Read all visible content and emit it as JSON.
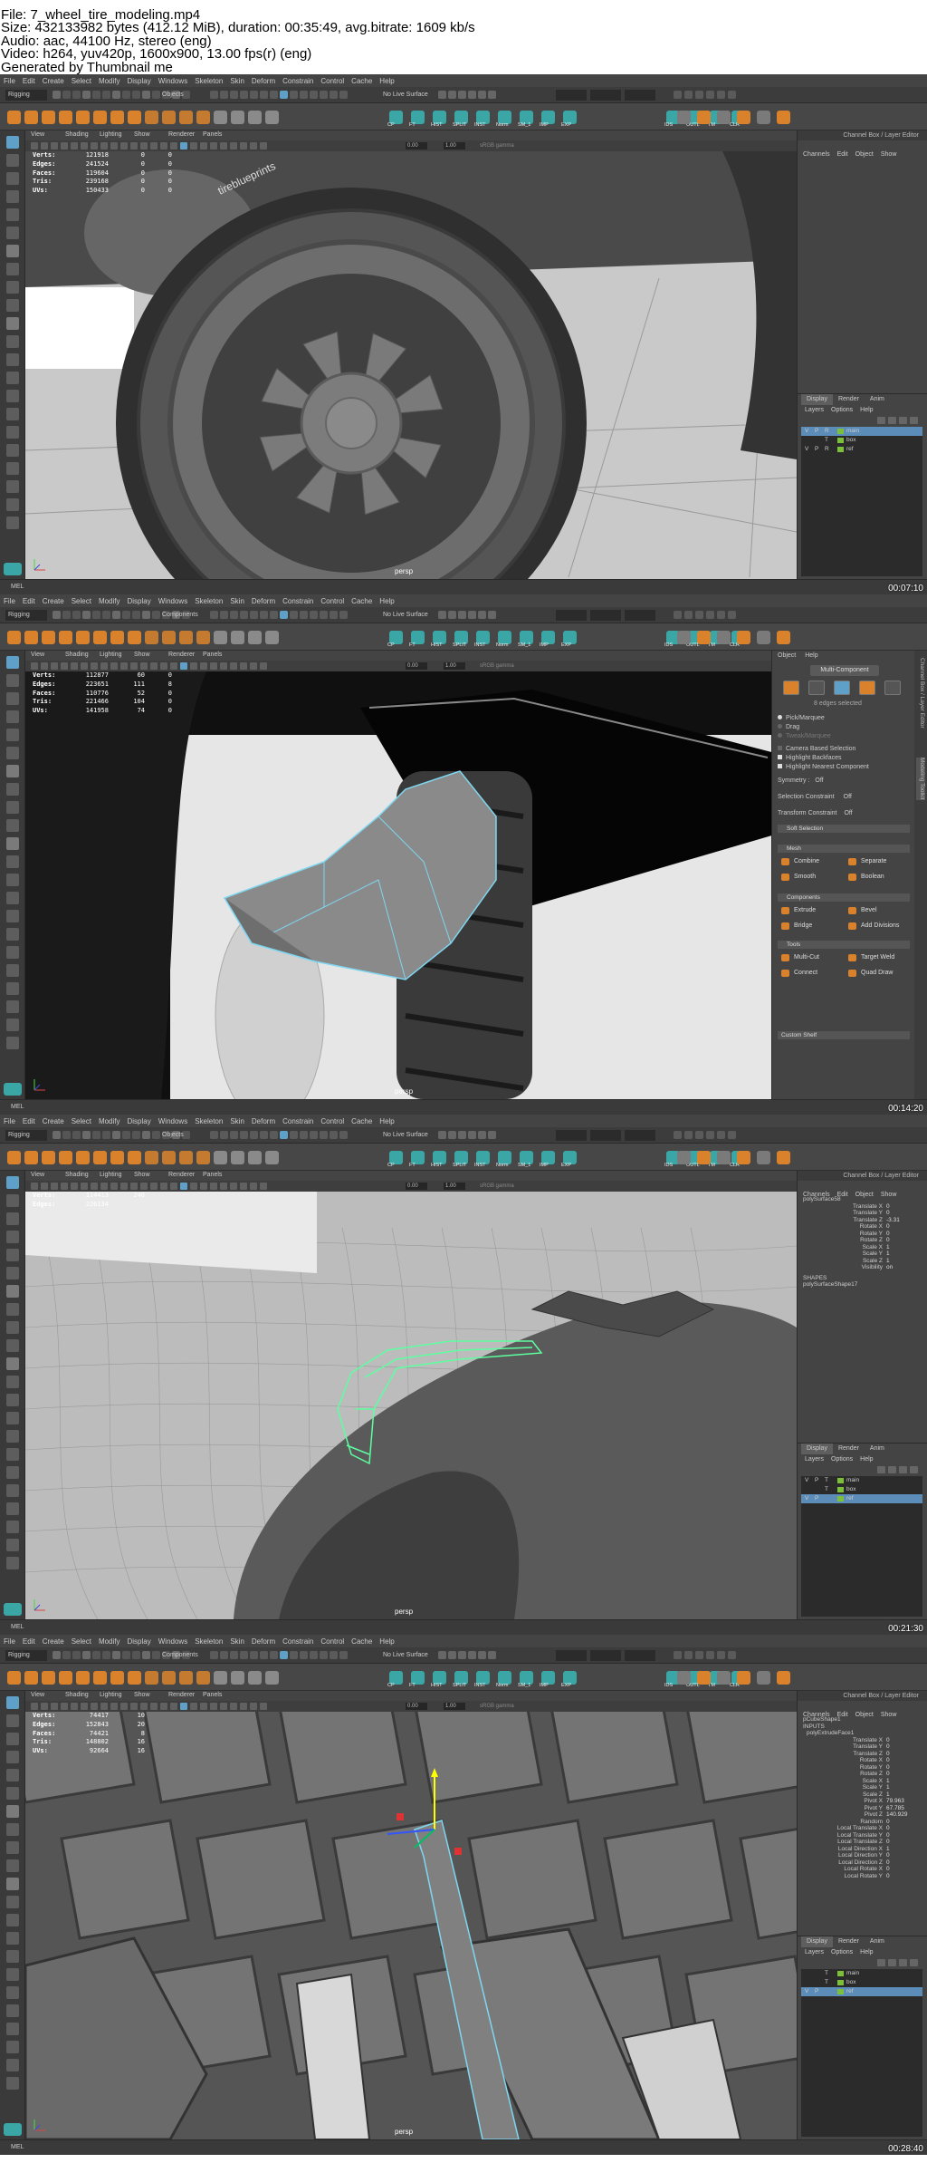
{
  "header": {
    "line1": "File: 7_wheel_tire_modeling.mp4",
    "line2": "Size: 432133982 bytes (412.12 MiB), duration: 00:35:49, avg.bitrate: 1609 kb/s",
    "line3": "Audio: aac, 44100 Hz, stereo (eng)",
    "line4": "Video: h264, yuv420p, 1600x900, 13.00 fps(r) (eng)",
    "line5": "Generated by Thumbnail me"
  },
  "menu": [
    "File",
    "Edit",
    "Create",
    "Select",
    "Modify",
    "Display",
    "Windows",
    "Skeleton",
    "Skin",
    "Deform",
    "Constrain",
    "Control",
    "Cache",
    "Help"
  ],
  "panel_menu": [
    "View",
    "Shading",
    "Lighting",
    "Show",
    "Renderer",
    "Panels"
  ],
  "mode": "Rigging",
  "live_surface": "No Live Surface",
  "shelf_labels": [
    "CP",
    "FT",
    "HIST",
    "SPLIT",
    "INST",
    "Norm",
    "SM_1",
    "IMP",
    "EXP",
    "IDS",
    "OUTL",
    "TM",
    "CLR"
  ],
  "cmd_label": "MEL",
  "camera": "persp",
  "gamma": "sRGB gamma",
  "exposure": "0.00",
  "gamma_value": "1.00",
  "colors": {
    "select_blue": "#5b8db8",
    "wire_cyan": "#7fd6f0",
    "wire_green": "#5dffa0",
    "orange_icon": "#d9822b",
    "teal_icon": "#3ba6a6",
    "layer_green": "#7bbf3a"
  },
  "frames": [
    {
      "timestamp": "00:07:10",
      "select_mode": "Objects",
      "hud": [
        [
          "Verts:",
          "121918",
          "0",
          "0"
        ],
        [
          "Edges:",
          "241524",
          "0",
          "0"
        ],
        [
          "Faces:",
          "119604",
          "0",
          "0"
        ],
        [
          "Tris:",
          "239168",
          "0",
          "0"
        ],
        [
          "UVs:",
          "150433",
          "0",
          "0"
        ]
      ],
      "panel_title": "Channel Box / Layer Editor",
      "cb_menu": [
        "Channels",
        "Edit",
        "Object",
        "Show"
      ],
      "layer_tabs": [
        "Display",
        "Render",
        "Anim"
      ],
      "layer_menu": [
        "Layers",
        "Options",
        "Help"
      ],
      "layers": [
        {
          "v": "V",
          "p": "P",
          "r": "R",
          "name": "main",
          "sel": true
        },
        {
          "v": "",
          "p": "",
          "r": "T",
          "name": "box",
          "sel": false
        },
        {
          "v": "V",
          "p": "P",
          "r": "R",
          "name": "ref",
          "sel": false
        }
      ]
    },
    {
      "timestamp": "00:14:20",
      "select_mode": "Components",
      "hud": [
        [
          "Verts:",
          "112877",
          "60",
          "0"
        ],
        [
          "Edges:",
          "223651",
          "111",
          "8"
        ],
        [
          "Faces:",
          "110776",
          "52",
          "0"
        ],
        [
          "Tris:",
          "221466",
          "104",
          "0"
        ],
        [
          "UVs:",
          "141958",
          "74",
          "0"
        ]
      ],
      "toolkit": {
        "menu": [
          "Object",
          "Help"
        ],
        "multi": "Multi-Component",
        "selected": "8 edges selected",
        "options": [
          "Pick/Marquee",
          "Drag",
          "Tweak/Marquee",
          "Camera Based Selection",
          "Highlight Backfaces",
          "Highlight Nearest Component"
        ],
        "symmetry": "Symmetry :",
        "symmetry_value": "Off",
        "sel_constraint": "Selection Constraint",
        "sel_constraint_value": "Off",
        "transform_constraint": "Transform Constraint",
        "transform_constraint_value": "Off",
        "soft": "Soft Selection",
        "mesh": "Mesh",
        "components": "Components",
        "tools": "Tools",
        "mesh_btns": [
          "Combine",
          "Separate",
          "Smooth",
          "Boolean"
        ],
        "comp_btns": [
          "Extrude",
          "Bevel",
          "Bridge",
          "Add Divisions"
        ],
        "tool_btns": [
          "Multi-Cut",
          "Target Weld",
          "Connect",
          "Quad Draw"
        ],
        "custom": "Custom Shelf",
        "vtabs": [
          "Channel Box / Layer Editor",
          "Modeling Toolkit"
        ]
      }
    },
    {
      "timestamp": "00:21:30",
      "select_mode": "Objects",
      "hud": [
        [
          "Verts:",
          "114413",
          "240",
          ""
        ],
        [
          "Edges:",
          "226134",
          "",
          ""
        ]
      ],
      "panel_title": "Channel Box / Layer Editor",
      "cb_menu": [
        "Channels",
        "Edit",
        "Object",
        "Show"
      ],
      "object": "polySurface58",
      "attrs": [
        [
          "Translate X",
          "0"
        ],
        [
          "Translate Y",
          "0"
        ],
        [
          "Translate Z",
          "-3.31"
        ],
        [
          "Rotate X",
          "0"
        ],
        [
          "Rotate Y",
          "0"
        ],
        [
          "Rotate Z",
          "0"
        ],
        [
          "Scale X",
          "1"
        ],
        [
          "Scale Y",
          "1"
        ],
        [
          "Scale Z",
          "1"
        ],
        [
          "Visibility",
          "on"
        ]
      ],
      "shapes": "SHAPES",
      "shape": "polySurfaceShape17",
      "layer_tabs": [
        "Display",
        "Render",
        "Anim"
      ],
      "layer_menu": [
        "Layers",
        "Options",
        "Help"
      ],
      "layers": [
        {
          "v": "V",
          "p": "P",
          "r": "T",
          "name": "main",
          "sel": false
        },
        {
          "v": "",
          "p": "",
          "r": "T",
          "name": "box",
          "sel": false
        },
        {
          "v": "V",
          "p": "P",
          "r": "",
          "name": "ref",
          "sel": true
        }
      ]
    },
    {
      "timestamp": "00:28:40",
      "select_mode": "Components",
      "hud": [
        [
          "Verts:",
          "74417",
          "10",
          ""
        ],
        [
          "Edges:",
          "152843",
          "20",
          ""
        ],
        [
          "Faces:",
          "74421",
          "8",
          ""
        ],
        [
          "Tris:",
          "148802",
          "16",
          ""
        ],
        [
          "UVs:",
          "92664",
          "16",
          ""
        ]
      ],
      "panel_title": "Channel Box / Layer Editor",
      "cb_menu": [
        "Channels",
        "Edit",
        "Object",
        "Show"
      ],
      "object": "pCubeShape1",
      "inputs": "INPUTS",
      "input_node": "polyExtrudeFace1",
      "attrs": [
        [
          "Translate X",
          "0"
        ],
        [
          "Translate Y",
          "0"
        ],
        [
          "Translate Z",
          "0"
        ],
        [
          "Rotate X",
          "0"
        ],
        [
          "Rotate Y",
          "0"
        ],
        [
          "Rotate Z",
          "0"
        ],
        [
          "Scale X",
          "1"
        ],
        [
          "Scale Y",
          "1"
        ],
        [
          "Scale Z",
          "1"
        ],
        [
          "Pivot X",
          "79.963"
        ],
        [
          "Pivot Y",
          "67.785"
        ],
        [
          "Pivot Z",
          "140.929"
        ],
        [
          "Random",
          "0"
        ],
        [
          "Local Translate X",
          "0"
        ],
        [
          "Local Translate Y",
          "0"
        ],
        [
          "Local Translate Z",
          "0"
        ],
        [
          "Local Direction X",
          "1"
        ],
        [
          "Local Direction Y",
          "0"
        ],
        [
          "Local Direction Z",
          "0"
        ],
        [
          "Local Rotate X",
          "0"
        ],
        [
          "Local Rotate Y",
          "0"
        ]
      ],
      "layer_tabs": [
        "Display",
        "Render",
        "Anim"
      ],
      "layer_menu": [
        "Layers",
        "Options",
        "Help"
      ],
      "layers": [
        {
          "v": "",
          "p": "",
          "r": "T",
          "name": "main",
          "sel": false
        },
        {
          "v": "",
          "p": "",
          "r": "T",
          "name": "box",
          "sel": false
        },
        {
          "v": "V",
          "p": "P",
          "r": "",
          "name": "ref",
          "sel": true
        }
      ]
    }
  ]
}
